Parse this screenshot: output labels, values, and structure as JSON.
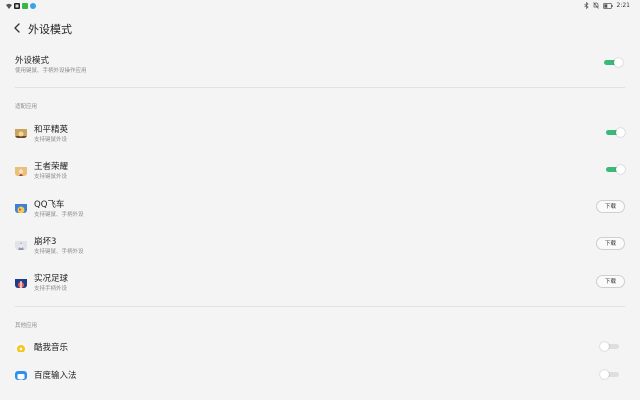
{
  "status_bar": {
    "time": "2:21",
    "icons": [
      "wifi-icon",
      "app-notification-icon",
      "app-notification-icon",
      "app-notification-icon",
      "bluetooth-icon",
      "mute-icon",
      "battery-icon"
    ]
  },
  "header": {
    "title": "外设模式",
    "back_icon": "back-arrow-icon"
  },
  "peripheral_mode": {
    "title": "外设模式",
    "subtitle": "使用键鼠、手柄外设操作应用",
    "enabled": true
  },
  "sections": {
    "supported_label": "适配应用",
    "other_label": "其他应用"
  },
  "supported_apps": [
    {
      "name": "和平精英",
      "subtitle": "支持键鼠外设",
      "control": "toggle",
      "enabled": true
    },
    {
      "name": "王者荣耀",
      "subtitle": "支持键鼠外设",
      "control": "toggle",
      "enabled": true
    },
    {
      "name": "QQ飞车",
      "subtitle": "支持键鼠、手柄外设",
      "control": "download",
      "button_label": "下载"
    },
    {
      "name": "崩坏3",
      "subtitle": "支持键鼠、手柄外设",
      "control": "download",
      "button_label": "下载"
    },
    {
      "name": "实况足球",
      "subtitle": "支持手柄外设",
      "control": "download",
      "button_label": "下载"
    }
  ],
  "other_apps": [
    {
      "name": "酷我音乐",
      "enabled": false
    },
    {
      "name": "百度输入法",
      "enabled": false
    }
  ],
  "colors": {
    "toggle_on": "#3cb878",
    "toggle_off": "#dedede",
    "background": "#f4f4f4"
  }
}
